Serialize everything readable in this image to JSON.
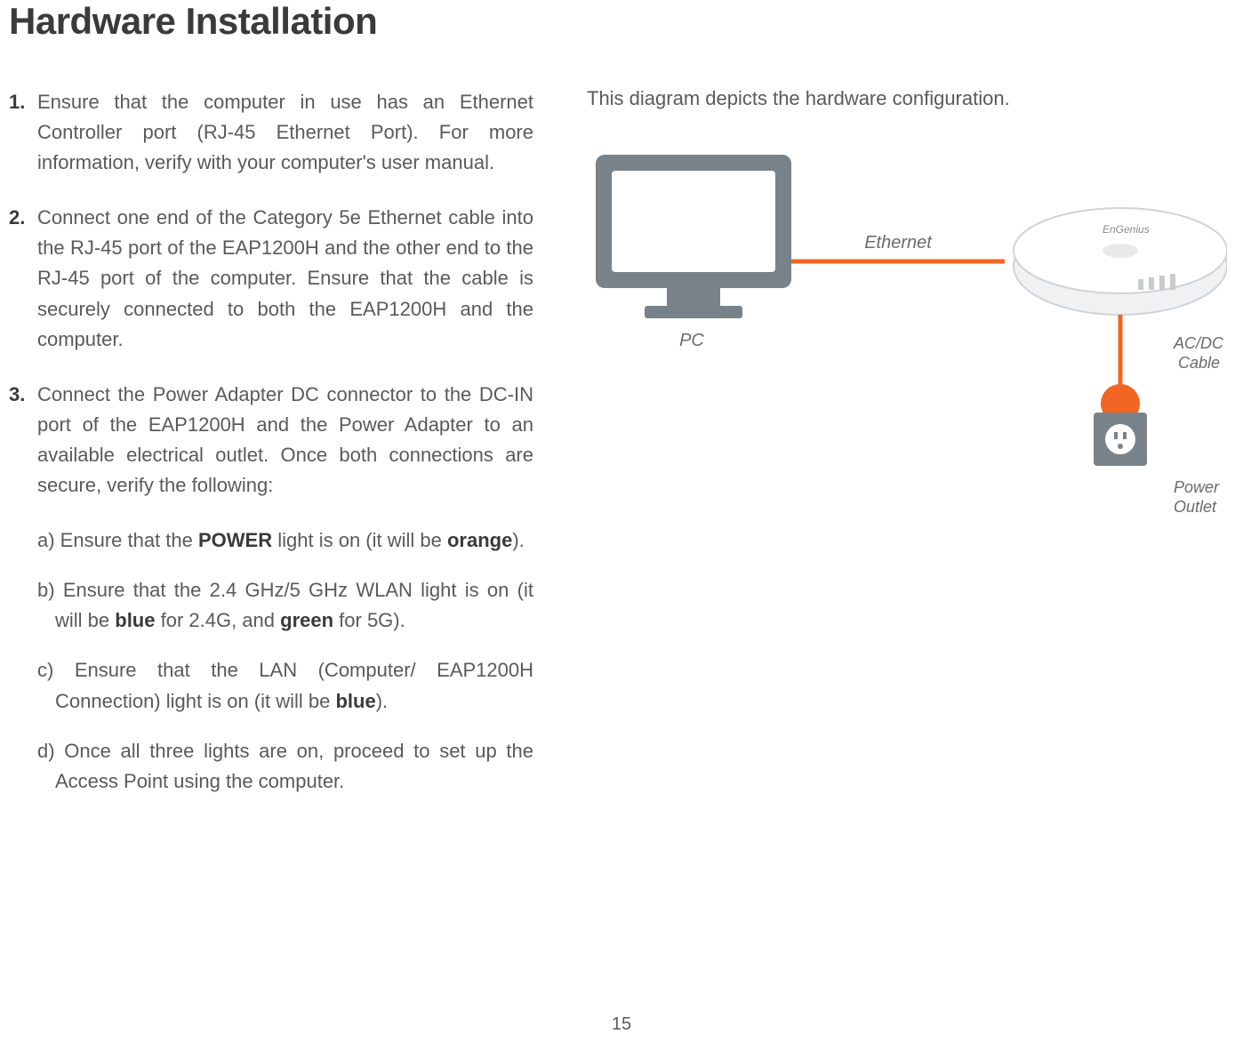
{
  "title": "Hardware Installation",
  "steps": {
    "s1_num": "1.",
    "s1": "Ensure that the computer in use has an Ethernet Controller port (RJ-45 Ethernet Port). For more information, verify with your computer's user manual.",
    "s2_num": "2.",
    "s2": "Connect one end of the Category 5e Ethernet cable into the RJ-45 port of the EAP1200H and the other end to the RJ-45 port of the computer. Ensure that the cable is securely connected to both the EAP1200H and the computer.",
    "s3_num": "3.",
    "s3": "Connect the Power Adapter DC connector to the DC-IN port of the EAP1200H and the Power Adapter to an available electrical outlet. Once both connections are secure, verify the following:",
    "sa_pre": "a) Ensure that the ",
    "sa_bold1": "POWER",
    "sa_mid": " light is on (it will be ",
    "sa_bold2": "orange",
    "sa_end": ").",
    "sb_pre": "b) Ensure that the 2.4 GHz/5 GHz WLAN light is on (it will be ",
    "sb_bold1": "blue",
    "sb_mid": " for 2.4G, and ",
    "sb_bold2": "green",
    "sb_end": " for 5G).",
    "sc_pre": "c) Ensure that the LAN (Computer/ EAP1200H Connection) light is on (it will be ",
    "sc_bold": "blue",
    "sc_end": ").",
    "sd": "d) Once all three lights are on, proceed to set up the Access Point using the computer."
  },
  "right": {
    "caption": "This diagram depicts the hardware configuration."
  },
  "diagram": {
    "pc_label": "PC",
    "ethernet_label": "Ethernet",
    "acdc_label": "AC/DC\nCable",
    "outlet_label": "Power\nOutlet",
    "brand_label": "EnGenius"
  },
  "page_number": "15"
}
